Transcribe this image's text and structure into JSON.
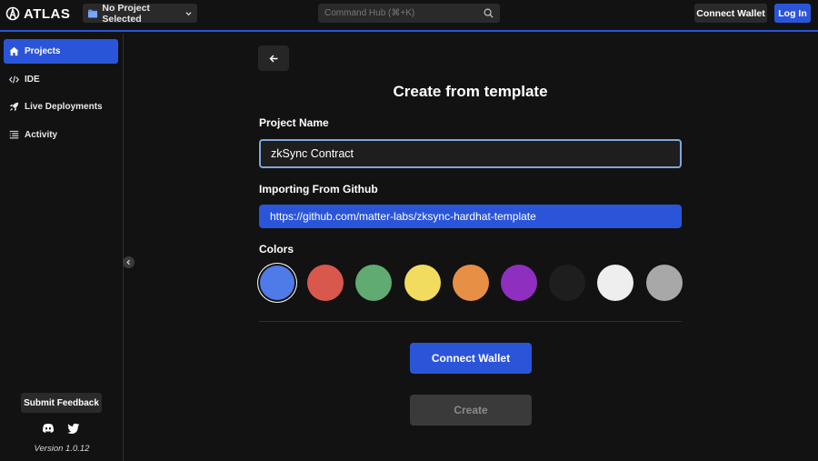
{
  "header": {
    "logo_text": "ATLAS",
    "project_selector": "No Project Selected",
    "command_hub_placeholder": "Command Hub (⌘+K)",
    "connect_wallet": "Connect Wallet",
    "login": "Log In"
  },
  "sidebar": {
    "items": [
      {
        "label": "Projects",
        "icon": "home-icon",
        "active": true
      },
      {
        "label": "IDE",
        "icon": "code-icon",
        "active": false
      },
      {
        "label": "Live Deployments",
        "icon": "rocket-icon",
        "active": false
      },
      {
        "label": "Activity",
        "icon": "list-icon",
        "active": false
      }
    ],
    "feedback": "Submit Feedback",
    "social_icons": [
      "discord-icon",
      "twitter-icon"
    ],
    "version": "Version 1.0.12"
  },
  "main": {
    "title": "Create from template",
    "project_name_label": "Project Name",
    "project_name_value": "zkSync Contract",
    "github_label": "Importing From Github",
    "github_value": "https://github.com/matter-labs/zksync-hardhat-template",
    "colors_label": "Colors",
    "colors": [
      "#4f7be8",
      "#d9584e",
      "#5fab72",
      "#f2dc5f",
      "#e88f46",
      "#8e2fbf",
      "#1e1e1e",
      "#eeeeee",
      "#a8a8a8"
    ],
    "selected_color_index": 0,
    "connect_wallet": "Connect Wallet",
    "create": "Create"
  },
  "theme": {
    "accent": "#2b55d9",
    "background": "#121212"
  }
}
